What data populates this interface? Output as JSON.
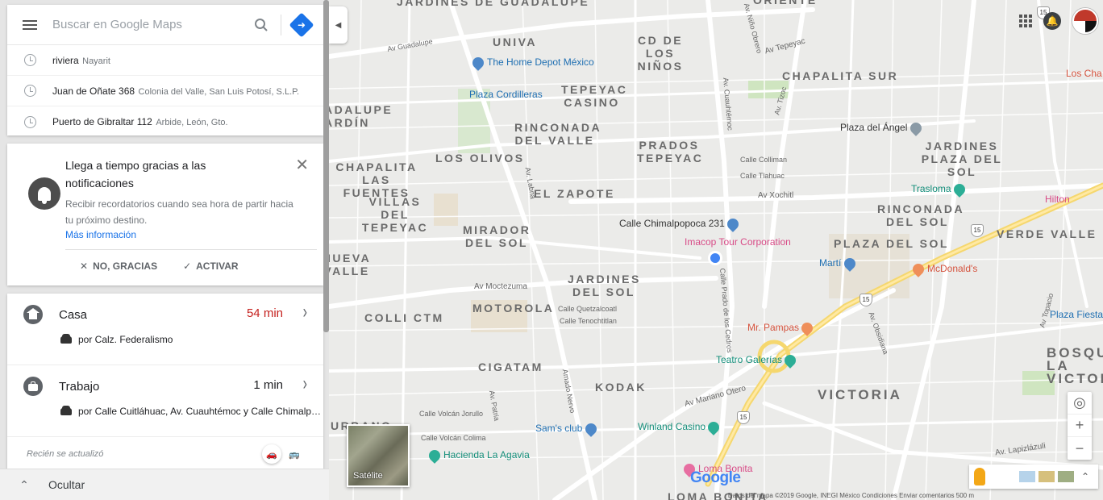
{
  "search": {
    "placeholder": "Buscar en Google Maps",
    "history": [
      {
        "main": "riviera",
        "sub": "Nayarit"
      },
      {
        "main": "Juan de Oñate 368",
        "sub": "Colonia del Valle, San Luis Potosí, S.L.P."
      },
      {
        "main": "Puerto de Gibraltar 112",
        "sub": "Arbide, León, Gto."
      }
    ]
  },
  "notification": {
    "title": "Llega a tiempo gracias a las notificaciones",
    "body": "Recibir recordatorios cuando sea hora de partir hacia tu próximo destino.",
    "link": "Más información",
    "dismiss": "NO, GRACIAS",
    "activate": "ACTIVAR"
  },
  "commute": {
    "items": [
      {
        "title": "Casa",
        "time": "54 min",
        "route": "por Calz. Federalismo"
      },
      {
        "title": "Trabajo",
        "time": "1 min",
        "route": "por Calle Cuitláhuac, Av. Cuauhtémoc y Calle Chimalpopoca"
      }
    ],
    "updated": "Recién se actualizó"
  },
  "hide_label": "Ocultar",
  "map": {
    "satellite_label": "Satélite",
    "logo": "Google",
    "attribution": "Datos del mapa ©2019 Google, INEGI   México   Condiciones   Enviar comentarios   500 m",
    "neighborhoods": [
      "JARDINES DE GUADALUPE",
      "UNIVA",
      "CD DE LOS NIÑOS",
      "CHAPALITA SUR",
      "ORIENTE",
      "TEPEYAC CASINO",
      "RINCONADA DEL VALLE",
      "PRADOS TEPEYAC",
      "LOS OLIVOS",
      "EL ZAPOTE",
      "JARDINES PLAZA DEL SOL",
      "CHAPALITA LAS FUENTES",
      "VILLAS DEL TEPEYAC",
      "MIRADOR DEL SOL",
      "RINCONADA DEL SOL",
      "PLAZA DEL SOL",
      "VERDE VALLE",
      "NUEVA VALLE",
      "JARDINES DEL SOL",
      "MOTOROLA",
      "COLLI CTM",
      "CIGATAM",
      "KODAK",
      "VICTORIA",
      "BOSQUE LA VICTORIA",
      "URBANO",
      "LOMA BONITA",
      "ADALUPE ARDÍN"
    ],
    "pois": [
      "The Home Depot México",
      "Plaza Cordilleras",
      "Plaza del Ángel",
      "Trasloma",
      "Hilton",
      "Calle Chimalpopoca 231",
      "Imacop Tour Corporation",
      "Martí",
      "McDonald's",
      "Plaza Fiesta Ar",
      "Mr. Pampas",
      "Teatro Galerías",
      "Sam's club",
      "Winland Casino",
      "Hacienda La Agavia",
      "Loma Bonita",
      "Los Cha"
    ],
    "streets": [
      "Av Guadalupe",
      "Av Tepeyac",
      "Av Xochitl",
      "Av Moctezuma",
      "Av Mariano Otero",
      "Av. Lapizlázuli",
      "Av. Niño Obrero",
      "Av. Cuauhtémoc",
      "Av. Tizoc",
      "Av. Labna",
      "Amado Nervo",
      "Av. Patria",
      "Av Topacio",
      "Av. Obsidiana",
      "Calle Colliman",
      "Calle Tlahuac",
      "Calle Quetzalcoatl",
      "Calle Tenochtitlan",
      "Calle Prado de los Cedros",
      "Calle Volcán Jorullo",
      "Calle Volcán Colima"
    ],
    "highway_labels": [
      "15",
      "15",
      "15",
      "15"
    ]
  }
}
